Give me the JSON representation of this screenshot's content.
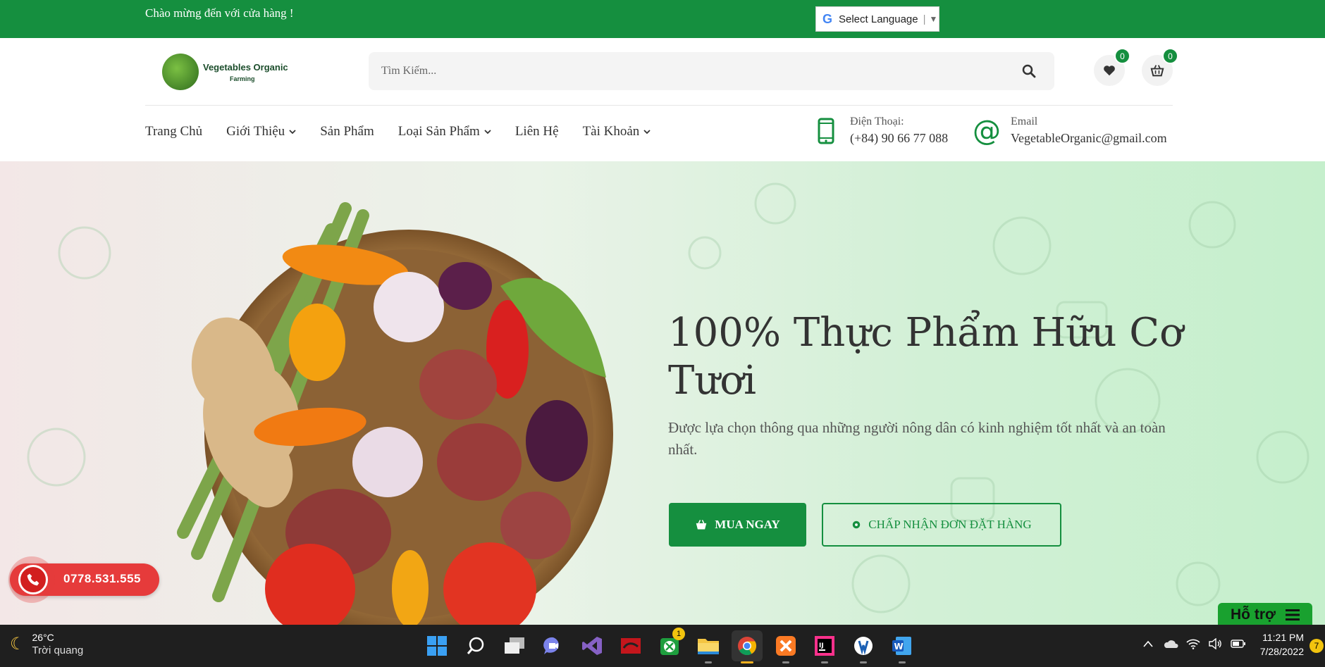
{
  "topbar": {
    "welcome": "Chào mừng đến với cửa hàng !",
    "language_label": "Select Language"
  },
  "logo": {
    "line1": "Vegetables Organic",
    "line2": "Farming"
  },
  "search": {
    "placeholder": "Tìm Kiếm..."
  },
  "header": {
    "wishlist_count": "0",
    "cart_count": "0"
  },
  "nav": {
    "items": [
      {
        "label": "Trang Chủ",
        "dropdown": false
      },
      {
        "label": "Giới Thiệu",
        "dropdown": true
      },
      {
        "label": "Sản Phẩm",
        "dropdown": false
      },
      {
        "label": "Loại Sản Phẩm",
        "dropdown": true
      },
      {
        "label": "Liên Hệ",
        "dropdown": false
      },
      {
        "label": "Tài Khoản",
        "dropdown": true
      }
    ]
  },
  "contact": {
    "phone_label": "Điện Thoại:",
    "phone_value": "(+84) 90 66 77 088",
    "email_label": "Email",
    "email_value": "VegetableOrganic@gmail.com"
  },
  "hero": {
    "title": "100% Thực Phẩm Hữu Cơ Tươi",
    "subtitle": "Được lựa chọn thông qua những người nông dân có kinh nghiệm tốt nhất và an toàn nhất.",
    "buy_label": "MUA NGAY",
    "accept_label": "CHẤP NHẬN ĐƠN ĐẶT HÀNG"
  },
  "hotline": {
    "number": "0778.531.555"
  },
  "support": {
    "label": "Hỗ trợ"
  },
  "taskbar": {
    "weather_temp": "26°C",
    "weather_desc": "Trời quang",
    "time": "11:21 PM",
    "date": "7/28/2022",
    "notification_count": "7",
    "xbox_badge": "1",
    "apps": [
      "start",
      "search",
      "task-view",
      "teams",
      "visual-studio",
      "app-red",
      "xbox",
      "file-explorer",
      "chrome",
      "xampp",
      "intellij",
      "app-blue",
      "word"
    ]
  },
  "colors": {
    "brand_green": "#158f3f",
    "hotline_red": "#e63b3b"
  }
}
